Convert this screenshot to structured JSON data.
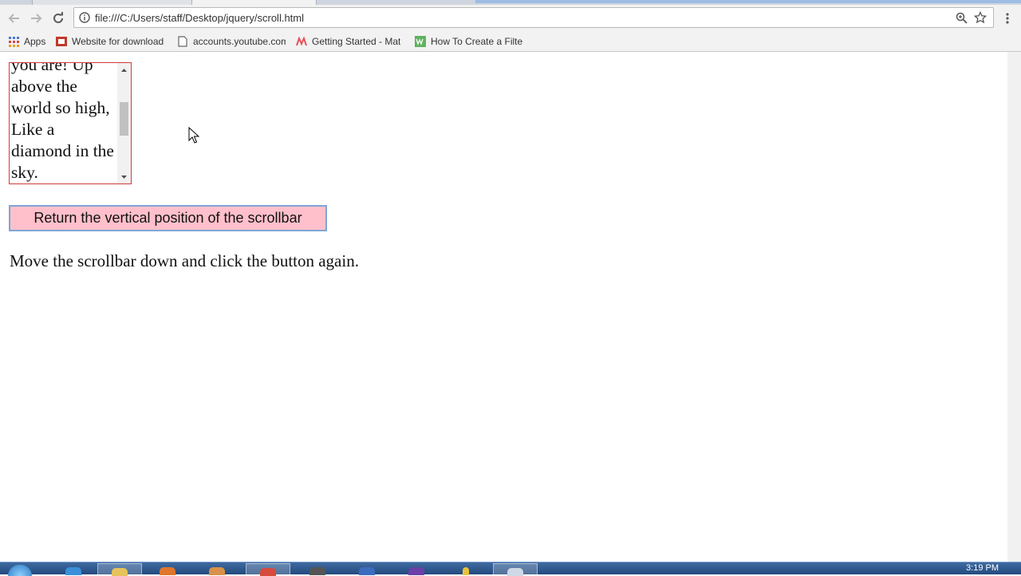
{
  "browser": {
    "url": "file:///C:/Users/staff/Desktop/jquery/scroll.html",
    "bookmarks": [
      {
        "label": "Apps",
        "icon": "apps-grid-icon"
      },
      {
        "label": "Website for download",
        "icon": "site-favicon-icon"
      },
      {
        "label": "accounts.youtube.com",
        "icon": "page-icon"
      },
      {
        "label": "Getting Started - Mat",
        "icon": "materialize-icon"
      },
      {
        "label": "How To Create a Filte",
        "icon": "w3schools-icon"
      }
    ]
  },
  "page": {
    "scroll_box_text": "you are! Up above the world so high, Like a diamond in the sky.",
    "button_label": "Return the vertical position of the scrollbar",
    "instruction": "Move the scrollbar down and click the button again."
  },
  "taskbar": {
    "clock": "3:19 PM"
  },
  "colors": {
    "button_bg": "#ffc0cb",
    "scroll_box_border": "#d23a3a",
    "button_border": "#7ea6d6"
  }
}
